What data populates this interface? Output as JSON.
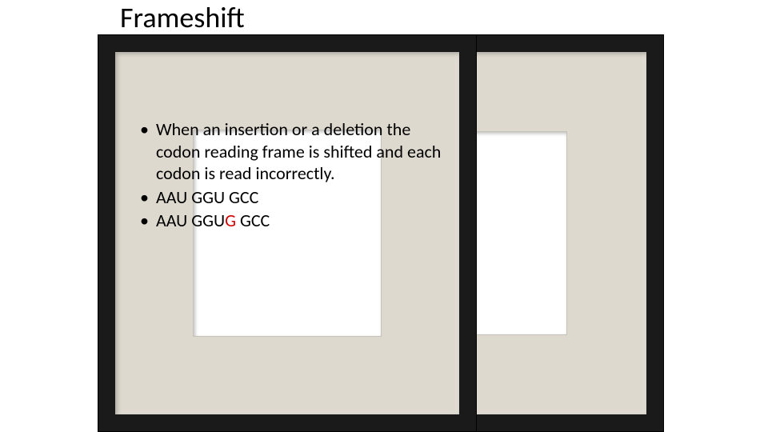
{
  "title": "Frameshift",
  "bullets": {
    "b1": "When an insertion or a deletion the codon reading frame is shifted and each codon is read incorrectly.",
    "b2_a": "AAU GGU GCC",
    "b3_a": "AAU GGU",
    "b3_red": "G",
    "b3_b": " GCC"
  }
}
